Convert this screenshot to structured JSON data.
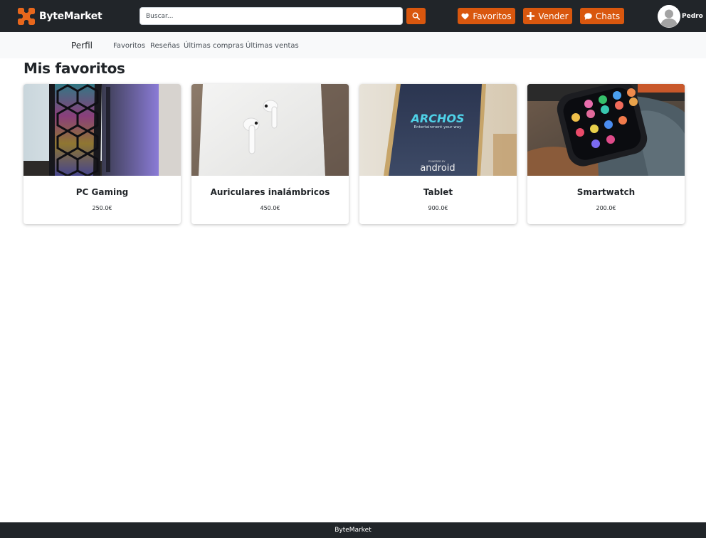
{
  "navbar": {
    "brand": "ByteMarket",
    "logo_icon": "bytemarket-logo-icon",
    "search": {
      "placeholder": "Buscar...",
      "value": "",
      "icon": "search-icon"
    },
    "buttons": [
      {
        "label": "Favoritos",
        "icon": "heart-icon"
      },
      {
        "label": "Vender",
        "icon": "plus-icon"
      },
      {
        "label": "Chats",
        "icon": "chat-icon"
      }
    ],
    "user": {
      "name": "Pedro",
      "avatar_icon": "user-avatar-icon"
    }
  },
  "subnav": {
    "title": "Perfil",
    "links": [
      "Favoritos",
      "Reseñas",
      "Últimas compras",
      "Últimas ventas"
    ]
  },
  "main": {
    "title": "Mis favoritos",
    "products": [
      {
        "name": "PC Gaming",
        "price": "250.0€"
      },
      {
        "name": "Auriculares inalámbricos",
        "price": "450.0€"
      },
      {
        "name": "Tablet",
        "price": "900.0€"
      },
      {
        "name": "Smartwatch",
        "price": "200.0€"
      }
    ]
  },
  "footer": {
    "text": "ByteMarket"
  },
  "colors": {
    "navbar_bg": "#212529",
    "accent": "#d9570e",
    "subnav_bg": "#f8f9fa",
    "text": "#212529"
  }
}
